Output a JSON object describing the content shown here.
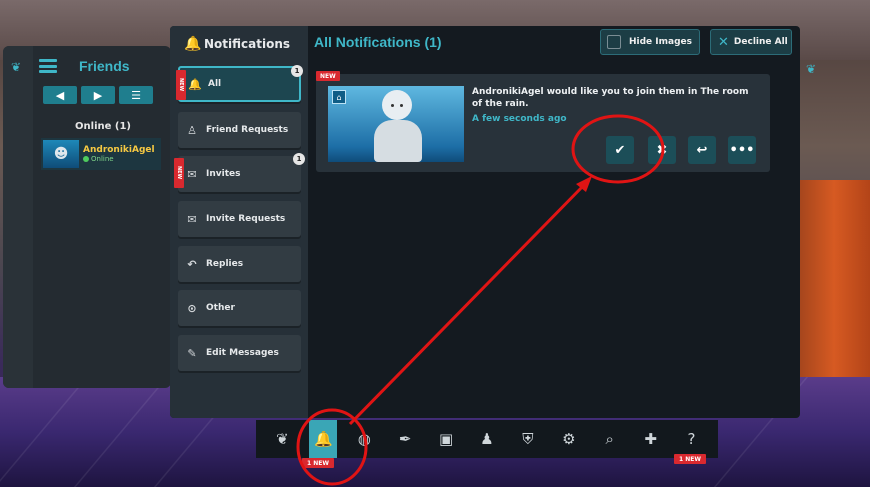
{
  "friends": {
    "title": "Friends",
    "online_label": "Online (1)",
    "friend": {
      "name": "AndronikiAgel",
      "status": "Online"
    }
  },
  "notifications": {
    "panel_title": "Notifications",
    "section_title": "All Notifications (1)",
    "hide_images_label": "Hide Images",
    "decline_all_label": "Decline All",
    "sidebar": [
      {
        "label": "All",
        "icon": "bell-icon",
        "count": "1",
        "new": true,
        "active": true
      },
      {
        "label": "Friend Requests",
        "icon": "person-add-icon"
      },
      {
        "label": "Invites",
        "icon": "envelope-icon",
        "count": "1",
        "new": true
      },
      {
        "label": "Invite Requests",
        "icon": "envelope-open-icon"
      },
      {
        "label": "Replies",
        "icon": "reply-icon"
      },
      {
        "label": "Other",
        "icon": "check-circle-icon"
      },
      {
        "label": "Edit Messages",
        "icon": "edit-icon"
      }
    ],
    "new_tag": "NEW",
    "card": {
      "new_label": "NEW",
      "message": "AndronikiAgel would like you to join them in The room of the rain.",
      "time": "A few seconds ago",
      "actions": [
        "accept-icon",
        "decline-icon",
        "reply-icon",
        "more-icon"
      ]
    }
  },
  "bottom_bar": {
    "icons": [
      "leaf-icon",
      "bell-icon",
      "globe-icon",
      "feather-icon",
      "book-icon",
      "group-icon",
      "shield-icon",
      "gear-icon",
      "search-icon",
      "chat-icon",
      "help-icon"
    ],
    "bell_badge": "1 NEW",
    "help_badge": "1 NEW"
  },
  "colors": {
    "accent": "#3fb7c8",
    "annotation": "#e01414",
    "badge": "#d9292f"
  }
}
